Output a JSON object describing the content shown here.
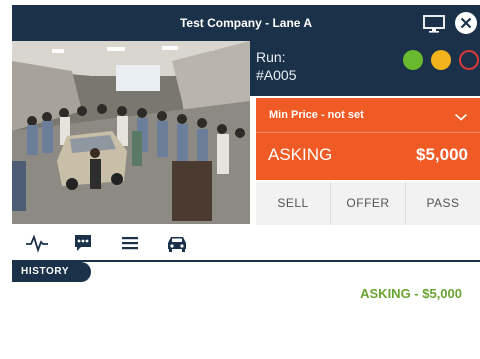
{
  "window": {
    "title": "Test Company - Lane A",
    "monitor_icon": "monitor-icon",
    "close_icon": "close-icon"
  },
  "camera": {
    "image": "lane-camera-feed"
  },
  "run": {
    "label": "Run:",
    "number": "#A005",
    "status_lights": [
      {
        "name": "green",
        "color": "#6aba2f",
        "filled": true
      },
      {
        "name": "yellow",
        "color": "#f2b31c",
        "filled": true
      },
      {
        "name": "red",
        "color": "#d8393a",
        "filled": false
      }
    ]
  },
  "price": {
    "min_price_label": "Min Price - not set",
    "dropdown_icon": "chevron-down-icon",
    "asking_label": "ASKING",
    "asking_value": "$5,000",
    "panel_color": "#ef5a25"
  },
  "actions": {
    "sell": "SELL",
    "offer": "OFFER",
    "pass": "PASS"
  },
  "tabs": [
    {
      "name": "activity",
      "icon": "pulse-icon"
    },
    {
      "name": "chat",
      "icon": "chat-icon"
    },
    {
      "name": "menu",
      "icon": "menu-icon"
    },
    {
      "name": "vehicle",
      "icon": "car-icon"
    }
  ],
  "history": {
    "label": "HISTORY",
    "entries": [
      "ASKING - $5,000"
    ],
    "entry_color": "#6aa432"
  },
  "colors": {
    "navy": "#1b3149",
    "accent": "#ef5a25"
  }
}
